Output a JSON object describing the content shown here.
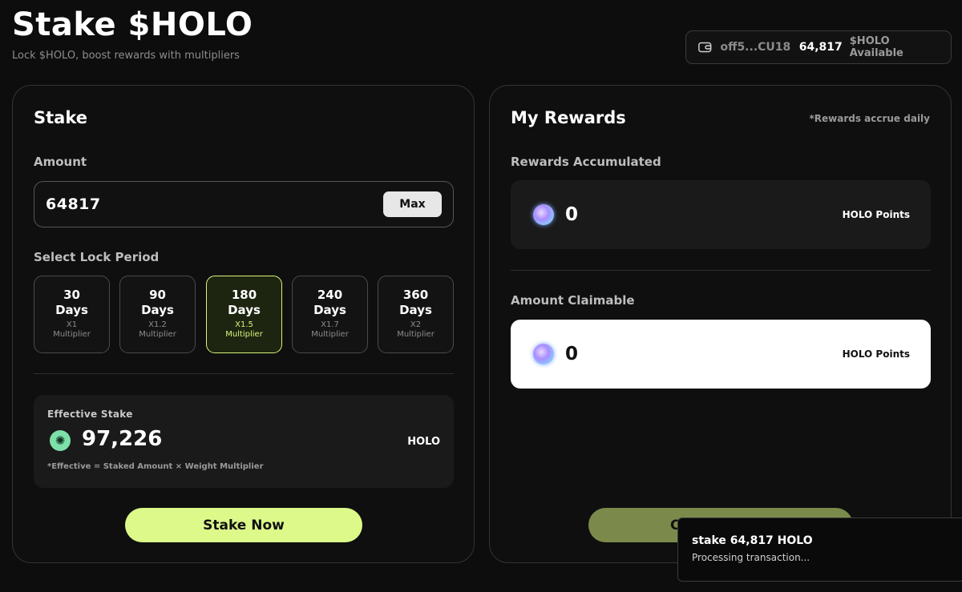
{
  "header": {
    "title": "Stake $HOLO",
    "subtitle": "Lock $HOLO, boost rewards with multipliers"
  },
  "wallet": {
    "icon": "wallet-icon",
    "address": "off5...CU18",
    "balance": "64,817",
    "balance_label": "$HOLO Available"
  },
  "stake_card": {
    "title": "Stake",
    "amount_label": "Amount",
    "amount_value": "64817",
    "max_label": "Max",
    "period_label": "Select Lock Period",
    "periods": [
      {
        "num": "30",
        "unit": "Days",
        "mult": "X1",
        "mult_label": "Multiplier",
        "selected": false
      },
      {
        "num": "90",
        "unit": "Days",
        "mult": "X1.2",
        "mult_label": "Multiplier",
        "selected": false
      },
      {
        "num": "180",
        "unit": "Days",
        "mult": "X1.5",
        "mult_label": "Multiplier",
        "selected": true
      },
      {
        "num": "240",
        "unit": "Days",
        "mult": "X1.7",
        "mult_label": "Multiplier",
        "selected": false
      },
      {
        "num": "360",
        "unit": "Days",
        "mult": "X2",
        "mult_label": "Multiplier",
        "selected": false
      }
    ],
    "effective": {
      "label": "Effective Stake",
      "value": "97,226",
      "unit": "HOLO",
      "note": "*Effective = Staked Amount × Weight Multiplier",
      "icon": "holo-token-icon"
    },
    "stake_button": "Stake Now"
  },
  "rewards_card": {
    "title": "My Rewards",
    "note": "*Rewards accrue daily",
    "accumulated_label": "Rewards Accumulated",
    "accumulated_value": "0",
    "accumulated_unit": "HOLO Points",
    "claimable_label": "Amount Claimable",
    "claimable_value": "0",
    "claimable_unit": "HOLO Points",
    "claim_button_visible": "C",
    "icon": "holo-points-orb-icon"
  },
  "toast": {
    "title": "stake 64,817 HOLO",
    "message": "Processing transaction..."
  },
  "colors": {
    "accent": "#dcf98a",
    "selected_border": "#d8f57c",
    "background": "#0d0d0d"
  }
}
